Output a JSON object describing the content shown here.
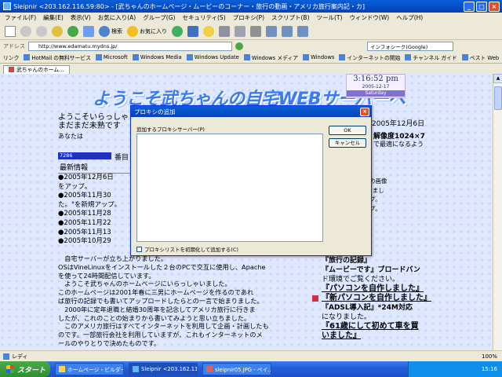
{
  "window": {
    "title": "Sleipnir <203.162.116.59:80> - [武ちゃんのホームページ・ムービーのコーナー・旅行の動画・アメリカ旅行案内記・カ]"
  },
  "menu": [
    "ファイル(F)",
    "編集(E)",
    "表示(V)",
    "お気に入り(A)",
    "グループ(G)",
    "セキュリティ(S)",
    "プロキシ(P)",
    "スクリプト(B)",
    "ツール(T)",
    "ウィンドウ(W)",
    "ヘルプ(H)"
  ],
  "toolbar": {
    "search_label": "検索",
    "favorites_label": "お気に入り"
  },
  "address": {
    "label": "アドレス",
    "url": "http://www.edamatu.mydns.jp/",
    "search_engine": "インフォシーク(Google)"
  },
  "links_bar": {
    "label": "リンク",
    "items": [
      "HotMail の無料サービス",
      "Microsoft",
      "Windows Media",
      "Windows Update",
      "Windows メディア",
      "Windows",
      "インターネットの開始",
      "チャンネル ガイド",
      "ベスト Web"
    ]
  },
  "tab": {
    "label": "武ちゃんのホーム..."
  },
  "page": {
    "site_title": "ようこそ武ちゃんの自宅WEBサーバーへ",
    "clock_time": "3:16:52 pm",
    "clock_date": "2005-12-17",
    "clock_day": "Saturday",
    "welcome_line1": "ようこそいらっしゃ",
    "welcome_line2": "まだまだ未熟です",
    "anata": "あなたは",
    "date_right": "2005年12月6日",
    "res_line1": "解像度1024×7",
    "res_line2": "で最適になるよう",
    "counter": "7286",
    "counter_suffix": "番目",
    "news_header": "最新情報",
    "news": [
      "●2005年12月6日",
      "をアップ。",
      "●2005年11月30",
      "た。\"を新規アップ。",
      "●2005年11月28",
      "●2005年11月22",
      "●2005年11月13",
      "●2005年10月29"
    ],
    "right_col": [
      "ークの構成\"の画像",
      "",
      "チャンとできまし",
      "",
      "\"を新規アップ。",
      "\"を新規アップ。"
    ],
    "body": [
      "　自宅サーバーが立ち上がりました。",
      "OSはVineLinuxをインストールした２台のPCで交互に使用し、Apache",
      "を使って24時間配信しています。",
      "　ようこそ武ちゃんのホームページにいらっしゃいました。",
      "このホームページは2001年春に三男にホームページを作るのであれ",
      "ば旅行の記録でも書いてアップロードしたらとの一言で始まりました。",
      "　2000年に定年退職と結婚30周年を記念してアメリカ旅行に行きま",
      "したが、これのことの始まりから書いてみようと思い立ちました。",
      "　このアメリカ旅行はすべてインターネットを利用して企画・計画したも",
      "のです。一部旅行会社を利用していますが、これもインターネットのメ",
      "ールのやりとりで決めたものです。"
    ],
    "links": [
      "『旅行の記録』",
      "『ムービーです』ブロードバン",
      "ド環境でご覧ください。",
      "『パソコンを自作しました』",
      "『新パソコンを自作しました』",
      "『ADSL導入記』*24M対応",
      "になりました。",
      "『61歳にして初めて車を買",
      "いました』"
    ]
  },
  "dialog": {
    "title": "プロキシの追加",
    "field_label": "追加するプロキシサーバー(P)",
    "ok_label": "OK",
    "cancel_label": "キャンセル",
    "checkbox_label": "プロキシリストを初期化して追加する(C)",
    "textarea_value": ""
  },
  "status": {
    "text": "レディ",
    "zoom": "100%"
  },
  "taskbar": {
    "start_label": "スタート",
    "tasks": [
      "ホームページ・ビルダー...",
      "Sleipnir <203.162.116...",
      "sleipnir05.JPG - ペイ..."
    ],
    "clock": "15:16"
  }
}
